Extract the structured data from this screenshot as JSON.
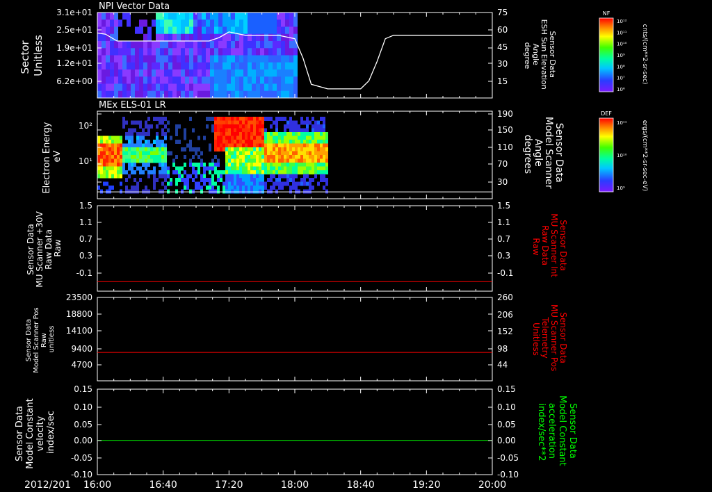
{
  "date_label": "2012/201",
  "time_ticks": [
    "16:00",
    "16:40",
    "17:20",
    "18:00",
    "18:40",
    "19:20",
    "20:00"
  ],
  "colors": {
    "background": "#000000",
    "axis": "#ffffff",
    "red_trace": "#ff0000",
    "green_trace": "#00ff00"
  },
  "panels": [
    {
      "title": "NPI Vector Data",
      "left_label": [
        "Sector",
        "Unitless"
      ],
      "left_ticks": [
        "3.1e+01",
        "2.5e+01",
        "1.9e+01",
        "1.2e+01",
        "6.2e+00"
      ],
      "right_ticks": [
        "75",
        "60",
        "45",
        "30",
        "15"
      ],
      "right_label": [
        "Sensor Data",
        "ESH Sun Elevation",
        "Angle",
        "degree"
      ],
      "colorbar": {
        "title": "NF",
        "tick_labels": [
          "10¹²",
          "10¹¹",
          "10¹⁰",
          "10⁹",
          "10⁸",
          "10⁷",
          "10⁶"
        ],
        "units": "cnts/(cm**2-sr-sec)"
      }
    },
    {
      "title": "MEx ELS-01 LR",
      "left_label": [
        "Electron Energy",
        "eV"
      ],
      "left_ticks": [
        "10²",
        "10¹"
      ],
      "right_ticks": [
        "190",
        "150",
        "110",
        "70",
        "30"
      ],
      "right_label": [
        "Sensor Data",
        "Model Scanner",
        "Angle",
        "degrees"
      ],
      "colorbar": {
        "title": "DEF",
        "tick_labels": [
          "10¹¹",
          "10¹⁰",
          "10⁹"
        ],
        "units": "ergs/(cm**2-sr-sec-eV)"
      }
    },
    {
      "left_label": [
        "Sensor Data",
        "MU Scanner +30V",
        "Raw Data",
        "Raw"
      ],
      "left_ticks": [
        "1.5",
        "1.1",
        "0.7",
        "0.3",
        "-0.1"
      ],
      "right_ticks": [
        "1.5",
        "1.1",
        "0.7",
        "0.3",
        "-0.1"
      ],
      "right_label": [
        "Sensor Data",
        "MU Scanner Int",
        "Raw Data",
        "Raw"
      ]
    },
    {
      "left_label": [
        "Sensor Data",
        "Model Scanner Pos",
        "Raw",
        "unitless"
      ],
      "left_ticks": [
        "23500",
        "18800",
        "14100",
        "9400",
        "4700"
      ],
      "right_ticks": [
        "260",
        "206",
        "152",
        "98",
        "44"
      ],
      "right_label": [
        "Sensor Data",
        "MU Scanner Pos",
        "Telemetry",
        "Unitless"
      ]
    },
    {
      "left_label": [
        "Sensor Data",
        "Model Constant",
        "velocity",
        "index/sec"
      ],
      "left_ticks": [
        "0.15",
        "0.10",
        "0.05",
        "0.00",
        "-0.05",
        "-0.10"
      ],
      "right_ticks": [
        "0.15",
        "0.10",
        "0.05",
        "0.00",
        "-0.05",
        "-0.10"
      ],
      "right_label": [
        "Sensor Data",
        "Model Constant",
        "acceleration",
        "index/sec**2"
      ]
    }
  ],
  "chart_data": [
    {
      "type": "heatmap",
      "title": "NPI Vector Data",
      "x_range": [
        "16:00",
        "20:00"
      ],
      "ylabel": "Sector Unitless",
      "ylim": [
        0,
        31
      ],
      "data_end_time": "18:00",
      "overlay_line": {
        "name": "ESH Sun Elevation Angle",
        "axis": "right",
        "ylim": [
          0,
          75
        ],
        "x": [
          "16:00",
          "16:05",
          "16:12",
          "16:20",
          "16:40",
          "17:00",
          "17:08",
          "17:14",
          "17:20",
          "17:30",
          "17:40",
          "17:50",
          "18:00",
          "18:05",
          "18:10",
          "18:20",
          "18:30",
          "18:40",
          "18:45",
          "18:50",
          "18:55",
          "19:00",
          "19:20",
          "19:40",
          "20:00"
        ],
        "values": [
          57,
          56,
          50,
          50,
          50,
          50,
          50,
          53,
          58,
          55,
          55,
          55,
          52,
          35,
          12,
          8,
          8,
          8,
          15,
          32,
          52,
          55,
          55,
          55,
          55
        ]
      }
    },
    {
      "type": "heatmap",
      "title": "MEx ELS-01 LR",
      "x_range": [
        "16:00",
        "20:00"
      ],
      "ylabel": "Electron Energy eV",
      "scale": "log",
      "data_end_time": "18:20",
      "overlay_line": {
        "name": "Model Scanner Angle",
        "axis": "right",
        "ylim": [
          0,
          190
        ],
        "x": [
          "16:00",
          "20:00"
        ],
        "values": [
          15,
          15
        ]
      }
    },
    {
      "type": "line",
      "x_range": [
        "16:00",
        "20:00"
      ],
      "ylim": [
        -0.3,
        1.5
      ],
      "series": [
        {
          "name": "MU Scanner Int Raw Data",
          "color": "#ff0000",
          "x": [
            "16:00",
            "20:00"
          ],
          "values": [
            -0.1,
            -0.1
          ]
        }
      ]
    },
    {
      "type": "line",
      "x_range": [
        "16:00",
        "20:00"
      ],
      "ylim": [
        0,
        23500
      ],
      "right_ylim": [
        0,
        260
      ],
      "series": [
        {
          "name": "MU Scanner Pos Telemetry",
          "color": "#ff0000",
          "x": [
            "16:00",
            "20:00"
          ],
          "values": [
            8000,
            8000
          ]
        }
      ]
    },
    {
      "type": "line",
      "x_range": [
        "16:00",
        "20:00"
      ],
      "ylim": [
        -0.1,
        0.15
      ],
      "series": [
        {
          "name": "Model Constant acceleration",
          "color": "#00ff00",
          "x": [
            "16:00",
            "20:00"
          ],
          "values": [
            0.0,
            0.0
          ]
        }
      ]
    }
  ]
}
